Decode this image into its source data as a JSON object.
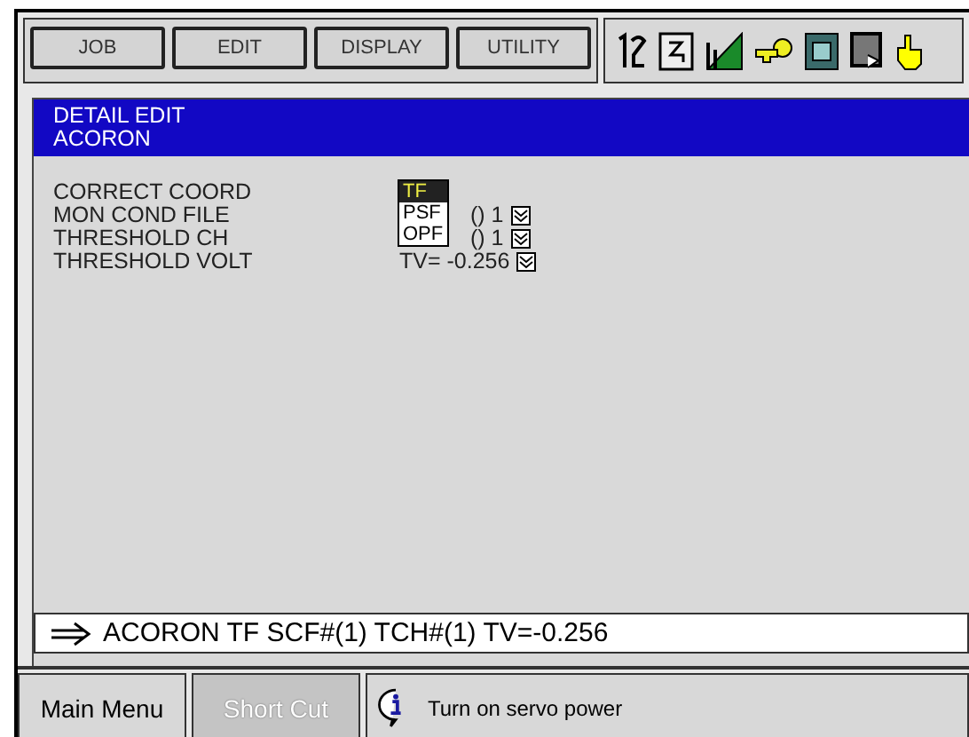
{
  "menu": [
    {
      "label": "JOB"
    },
    {
      "label": "EDIT"
    },
    {
      "label": "DISPLAY"
    },
    {
      "label": "UTILITY"
    }
  ],
  "header": {
    "title": "DETAIL EDIT",
    "subtitle": "ACORON"
  },
  "fields": [
    {
      "label": "CORRECT COORD"
    },
    {
      "label": "MON COND FILE",
      "value": "() 1",
      "has_select": true
    },
    {
      "label": "THRESHOLD CH",
      "value": "() 1",
      "has_select": true
    },
    {
      "label": "THRESHOLD VOLT",
      "value": "TV= -0.256",
      "has_select": true
    }
  ],
  "dropdown": {
    "options": [
      {
        "label": "TF",
        "selected": true
      },
      {
        "label": "PSF",
        "selected": false
      },
      {
        "label": "OPF",
        "selected": false
      }
    ]
  },
  "command_line": "ACORON TF SCF#(1) TCH#(1) TV=-0.256",
  "bottom_buttons": [
    {
      "label": "Main Menu",
      "disabled": false
    },
    {
      "label": "Short Cut",
      "disabled": true
    }
  ],
  "message": "Turn on servo power"
}
